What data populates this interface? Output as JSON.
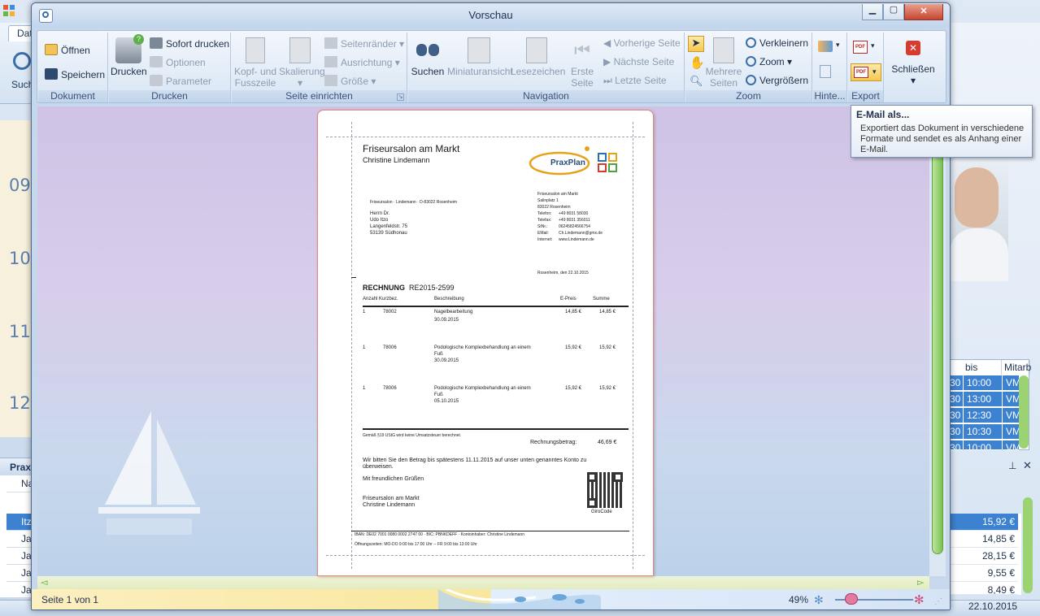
{
  "window": {
    "title": "Vorschau"
  },
  "ribbon": {
    "dokument": {
      "label": "Dokument",
      "open": "Öffnen",
      "save": "Speichern"
    },
    "drucken": {
      "label": "Drucken",
      "print": "Drucken",
      "quick_print": "Sofort drucken",
      "options": "Optionen",
      "parameters": "Parameter"
    },
    "seite": {
      "label": "Seite einrichten",
      "header_footer_1": "Kopf- und",
      "header_footer_2": "Fusszeile",
      "scaling": "Skalierung",
      "margins": "Seitenränder",
      "orientation": "Ausrichtung",
      "size": "Größe"
    },
    "navigation": {
      "label": "Navigation",
      "search": "Suchen",
      "thumbnails": "Miniaturansicht",
      "bookmarks": "Lesezeichen",
      "first_1": "Erste",
      "first_2": "Seite",
      "prev": "Vorherige Seite",
      "next": "Nächste Seite",
      "last": "Letzte Seite"
    },
    "zoom": {
      "label": "Zoom",
      "multi_1": "Mehrere",
      "multi_2": "Seiten",
      "zoom_out": "Verkleinern",
      "zoom": "Zoom",
      "zoom_in": "Vergrößern"
    },
    "hinter": {
      "label": "Hinte..."
    },
    "export": {
      "label": "Export"
    },
    "close": {
      "label": "Schließen"
    }
  },
  "tooltip": {
    "title": "E-Mail als...",
    "body": "Exportiert das Dokument in verschiedene Formate und sendet es als Anhang einer E-Mail."
  },
  "status": {
    "page": "Seite 1 von 1",
    "zoom": "49%"
  },
  "invoice": {
    "company": "Friseursalon am Markt",
    "owner": "Christine Lindemann",
    "logo_text": "PraxPlan",
    "sender_line": "Friseursalon · Lindemann · D-83022 Rosenheim",
    "recipient": [
      "Herrn Dr.",
      "Udo Itzo",
      "Langenfeldstr. 75",
      "53139 Südhonau"
    ],
    "contact": [
      [
        "",
        "Friseursalon am Markt"
      ],
      [
        "",
        "Salinplatz 1"
      ],
      [
        "",
        "83022 Rosenheim"
      ],
      [
        "Telefon:",
        "+49 8031 58030"
      ],
      [
        "Telefax:",
        "+49 8031 356011"
      ],
      [
        "StNr.:",
        "06245824566754"
      ],
      [
        "EMail:",
        "Ch.Lindemann@gmx.de"
      ],
      [
        "Internet:",
        "www.Lindemann.de"
      ]
    ],
    "place_date": "Rosenheim, den 22.10.2015",
    "title": "RECHNUNG",
    "number": "RE2015-2599",
    "columns": [
      "Anzahl Kurzbez.",
      "Beschreibung",
      "E-Preis",
      "Summe"
    ],
    "items": [
      {
        "qty": "1",
        "code": "78002",
        "desc": "Nagelbearbeitung",
        "desc2": "",
        "date": "30.09.2015",
        "price": "14,85 €",
        "sum": "14,85 €"
      },
      {
        "qty": "1",
        "code": "78006",
        "desc": "Podologische Komplexbehandlung an einem",
        "desc2": "Fuß",
        "date": "30.09.2015",
        "price": "15,92 €",
        "sum": "15,92 €"
      },
      {
        "qty": "1",
        "code": "78006",
        "desc": "Podologische Komplexbehandlung an einem",
        "desc2": "Fuß",
        "date": "05.10.2015",
        "price": "15,92 €",
        "sum": "15,92 €"
      }
    ],
    "vat_note": "Gemäß §19 UStG wird keine Umsatzsteuer berechnet.",
    "total_label": "Rechnungsbetrag:",
    "total": "46,69 €",
    "pay_text_1": "Wir bitten Sie den Betrag bis spätestens 11.11.2015 auf unser unten genanntes Konto zu",
    "pay_text_2": "überweisen.",
    "greeting": "Mit freundlichen Grüßen",
    "sign_1": "Friseursalon am Markt",
    "sign_2": "Christine Lindemann",
    "qr_label": "GiroCode",
    "bank_line": "IBAN: DE02 7001 0080 0002 2747 00  ·  BIC: PBNKDEFF  ·  Kontoinhaber: Christine Lindemann",
    "hours_line": "Öffnungszeiten: MO-DO  9:00 bis 17:00 Uhr  --  FR 9:00 bis 13:00 Uhr"
  },
  "background": {
    "tab": "Dat",
    "search": "Such",
    "times": [
      "09",
      "10",
      "11",
      "12"
    ],
    "panel": "Praxi",
    "rows": [
      "Na",
      "Itz",
      "Ja",
      "Ja",
      "Ja",
      "Ja"
    ],
    "table_headers": [
      "bis",
      "Mitarb"
    ],
    "table_rows": [
      [
        "30",
        "10:00",
        "VM"
      ],
      [
        "30",
        "13:00",
        "VM"
      ],
      [
        "30",
        "12:30",
        "VM"
      ],
      [
        "30",
        "10:30",
        "VM"
      ],
      [
        "30",
        "10:00",
        "VM"
      ]
    ],
    "amounts": [
      "15,92 €",
      "14,85 €",
      "28,15 €",
      "9,55 €",
      "8,49 €"
    ],
    "date": "22.10.2015"
  },
  "colors": {
    "accent": "#3d82d1",
    "scroll_green": "#79c251",
    "preview_bg": "#d8cdea",
    "status_yellow": "#f8e79d"
  }
}
